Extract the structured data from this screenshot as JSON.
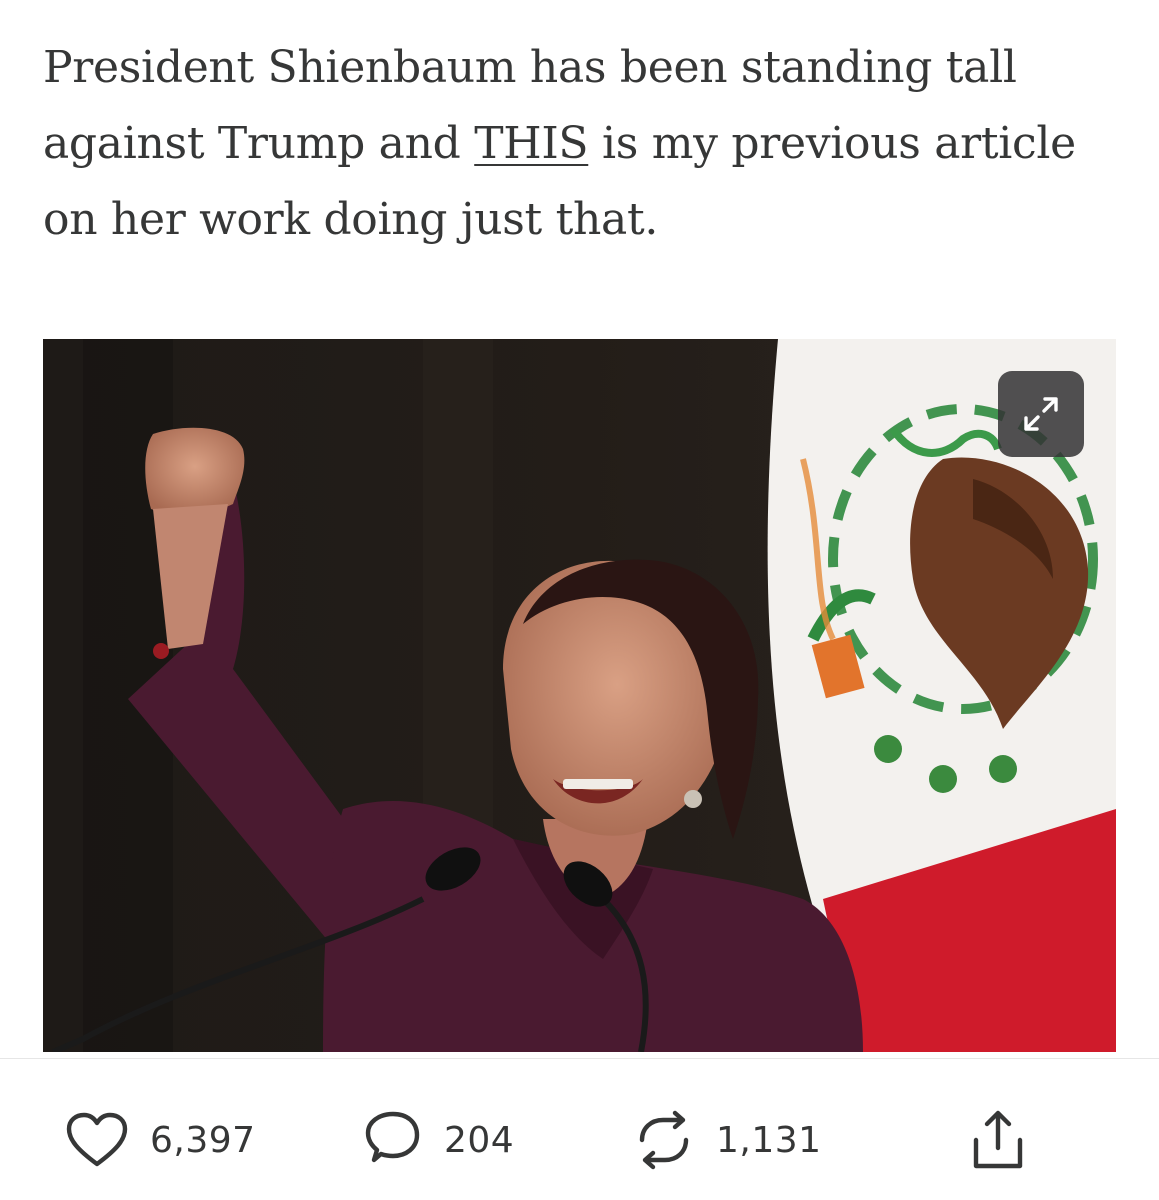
{
  "article": {
    "text_before_link": "President Shienbaum has been standing tall against Trump and ",
    "link_text": "THIS",
    "text_after_link": " is my previous article on her work doing just that."
  },
  "photo": {
    "expand_icon": "expand-arrows-icon"
  },
  "actions": {
    "like": {
      "icon": "heart-icon",
      "count": "6,397"
    },
    "comment": {
      "icon": "comment-bubble-icon",
      "count": "204"
    },
    "restack": {
      "icon": "restack-arrows-icon",
      "count": "1,131"
    },
    "share": {
      "icon": "share-upload-icon"
    }
  },
  "colors": {
    "text": "#363737",
    "flag_green": "#0b6a3c",
    "flag_red": "#cf1b2b",
    "jacket": "#4a1a30"
  }
}
